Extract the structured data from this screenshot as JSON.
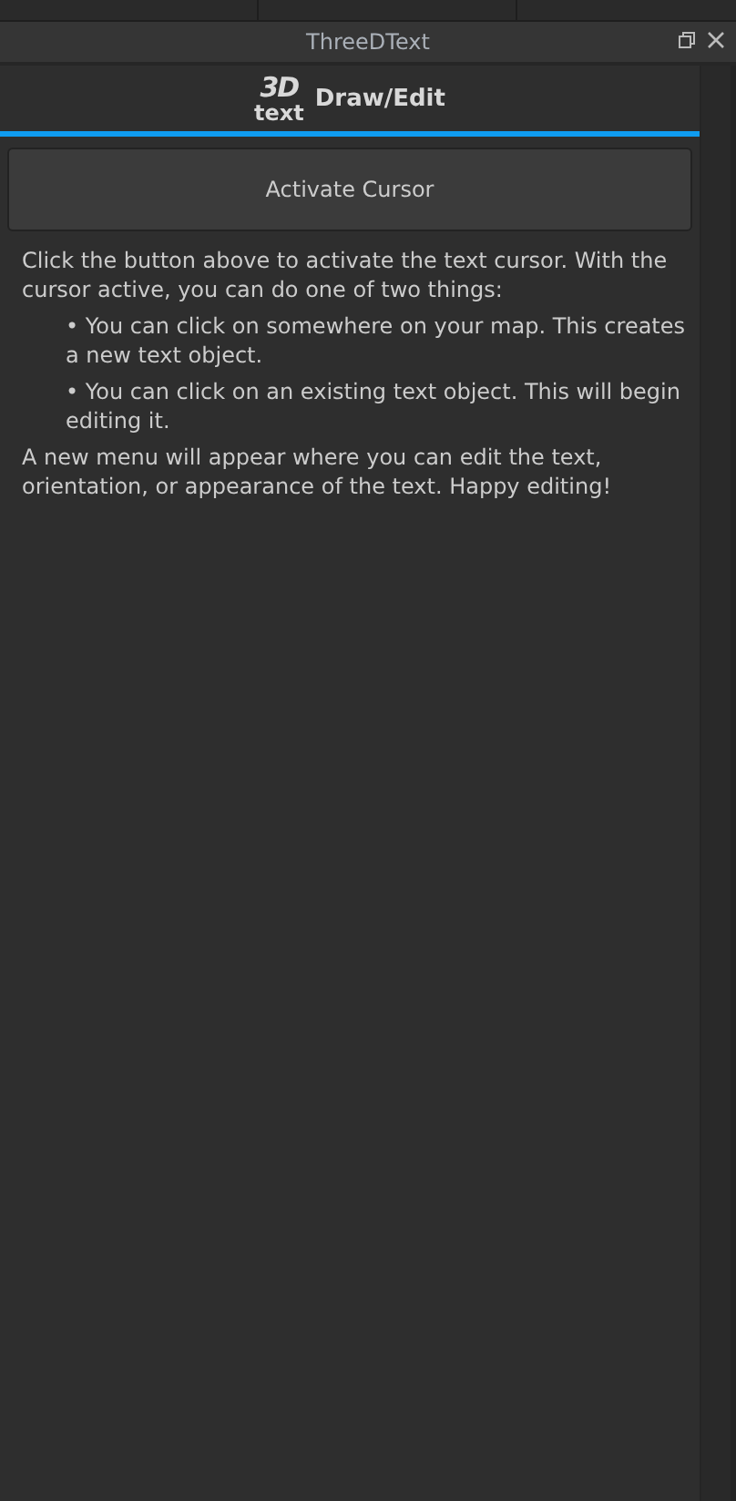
{
  "window": {
    "title": "ThreeDText"
  },
  "header": {
    "logo_top": "3D",
    "logo_bottom": "text",
    "title": "Draw/Edit"
  },
  "button": "Activate Cursor",
  "intro": "Click the button above to activate the text cursor. With the cursor active, you can do one of two things:",
  "bullets": [
    "• You can click on somewhere on your map. This creates a new text object.",
    "• You can click on an existing text object. This will begin editing it."
  ],
  "outro": "A new menu will appear where you can edit the text, orientation, or appearance of the text. Happy editing!"
}
